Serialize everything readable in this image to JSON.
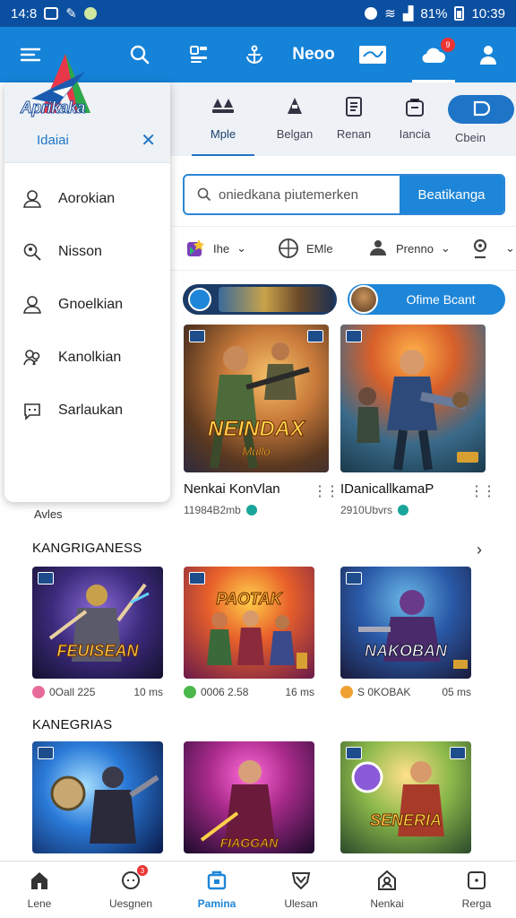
{
  "status_bar": {
    "time": "14:8",
    "battery": "81%",
    "clock": "10:39"
  },
  "app_bar": {
    "title": "Neoo",
    "notification_count": "9"
  },
  "drawer": {
    "logo_text": "Aprikaka",
    "subtitle": "Idaiai",
    "items": [
      {
        "label": "Aorokian",
        "icon": "user-icon"
      },
      {
        "label": "Nisson",
        "icon": "search-person-icon"
      },
      {
        "label": "Gnoelkian",
        "icon": "user-outline-icon"
      },
      {
        "label": "Kanolkian",
        "icon": "group-icon"
      },
      {
        "label": "Sarlaukan",
        "icon": "chat-icon"
      }
    ],
    "footer_text": "Avles"
  },
  "category_tabs": [
    {
      "label": "Mple",
      "icon": "people-icon"
    },
    {
      "label": "Belgan",
      "icon": "person-icon"
    },
    {
      "label": "Renan",
      "icon": "document-icon"
    },
    {
      "label": "Iancia",
      "icon": "bag-icon"
    },
    {
      "label": "Cbein",
      "icon": "chat-bubble-icon"
    }
  ],
  "search": {
    "placeholder": "oniedkana piutemerken",
    "button_label": "Beatikanga"
  },
  "filters": [
    {
      "label": "Ihe",
      "icon": "star-icon"
    },
    {
      "label": "EMle",
      "icon": "globe-icon"
    },
    {
      "label": "Prenno",
      "icon": "person-icon"
    },
    {
      "label": "",
      "icon": "account-icon"
    }
  ],
  "banners": {
    "promo_label": "Ofime Bcant"
  },
  "featured": [
    {
      "name": "Nenkai KonVlan",
      "meta": "11984B2mb",
      "art_title": "NEINDAX",
      "art_subtitle": "Mullo"
    },
    {
      "name": "IDanicallkamaP",
      "meta": "2910Ubvrs",
      "art_title": ""
    }
  ],
  "sections": [
    {
      "title": "KANGRIGANESS",
      "cards": [
        {
          "art_title": "FEUISEAN",
          "meta_left": "0Oall 225",
          "meta_right": "10 ms"
        },
        {
          "art_title": "PAOTAK",
          "meta_left": "0006 2.58",
          "meta_right": "16 ms"
        },
        {
          "art_title": "NAKOBAN",
          "meta_left": "S 0KOBAK",
          "meta_right": "05 ms"
        }
      ]
    },
    {
      "title": "KANEGRIAS",
      "cards": [
        {
          "art_title": ""
        },
        {
          "art_title": "FIAGGAN"
        },
        {
          "art_title": "SENERIA"
        }
      ]
    }
  ],
  "bottom_nav": [
    {
      "label": "Lene",
      "icon": "home-icon"
    },
    {
      "label": "Uesgnen",
      "icon": "chat-icon",
      "badge": "3"
    },
    {
      "label": "Pamina",
      "icon": "store-icon",
      "active": true
    },
    {
      "label": "Ulesan",
      "icon": "shield-icon"
    },
    {
      "label": "Nenkai",
      "icon": "profile-icon"
    },
    {
      "label": "Rerga",
      "icon": "square-icon"
    }
  ],
  "colors": {
    "primary": "#1583d8",
    "status_bar": "#0b4fa0",
    "accent": "#1e86d8",
    "badge": "#e33333"
  }
}
